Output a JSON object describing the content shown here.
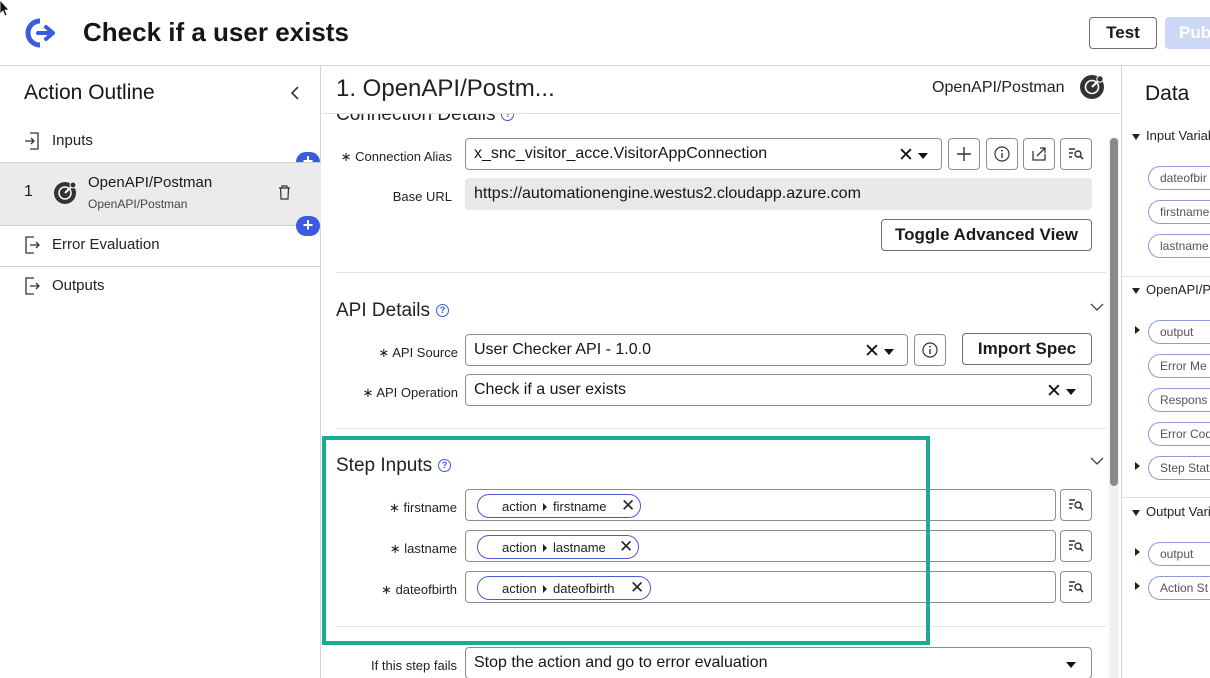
{
  "header": {
    "title": "Check if a user exists",
    "test_label": "Test",
    "publish_label": "Pub"
  },
  "outline": {
    "title": "Action Outline",
    "inputs_label": "Inputs",
    "step": {
      "number": "1",
      "name": "OpenAPI/Postman",
      "subtitle": "OpenAPI/Postman"
    },
    "error_label": "Error Evaluation",
    "outputs_label": "Outputs",
    "add_symbol": "+"
  },
  "main": {
    "title": "1.  OpenAPI/Postm...",
    "step_type": "OpenAPI/Postman",
    "connection": {
      "section_title": "Connection Details",
      "alias_label": "Connection Alias",
      "alias_value": "x_snc_visitor_acce.VisitorAppConnection",
      "base_url_label": "Base URL",
      "base_url_value": "https://automationengine.westus2.cloudapp.azure.com",
      "toggle_label": "Toggle Advanced View"
    },
    "api": {
      "section_title": "API Details",
      "source_label": "API Source",
      "source_value": "User Checker API - 1.0.0",
      "import_label": "Import Spec",
      "operation_label": "API Operation",
      "operation_value": "Check if a user exists"
    },
    "inputs": {
      "section_title": "Step Inputs",
      "rows": [
        {
          "label": "firstname",
          "pill_scope": "action",
          "pill_field": "firstname"
        },
        {
          "label": "lastname",
          "pill_scope": "action",
          "pill_field": "lastname"
        },
        {
          "label": "dateofbirth",
          "pill_scope": "action",
          "pill_field": "dateofbirth"
        }
      ]
    },
    "failure": {
      "label": "If this step fails",
      "value": "Stop the action and go to error evaluation"
    },
    "required_marker": "∗",
    "clear_symbol": "✕",
    "help_symbol": "?",
    "info_symbol": "i",
    "add_symbol": "+"
  },
  "data_panel": {
    "title": "Data",
    "groups": [
      {
        "label": "Input Variab",
        "pills": [
          "dateofbir",
          "firstname",
          "lastname"
        ]
      },
      {
        "label": "OpenAPI/Po",
        "pills": [
          "output",
          "Error Me",
          "Respons",
          "Error Cod",
          "Step Stat"
        ]
      },
      {
        "label": "Output Vari",
        "pills": [
          "output",
          "Action St"
        ]
      }
    ]
  },
  "colors": {
    "accent": "#3a5be0",
    "highlight": "#1aab96",
    "publish_disabled": "#cdd7f6"
  }
}
